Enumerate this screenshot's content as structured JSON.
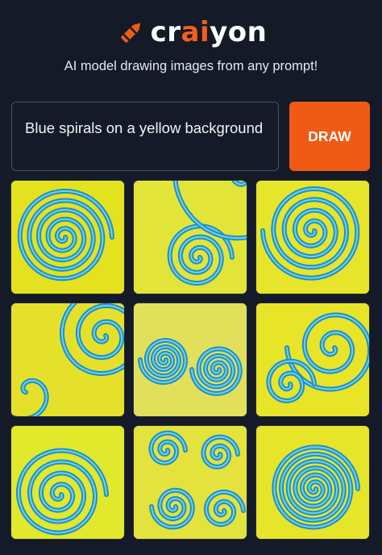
{
  "app": {
    "logo_text_prefix": "cr",
    "logo_text_accent": "ai",
    "logo_text_suffix": "yon",
    "logo_icon": "crayon-icon",
    "tagline": "AI model drawing images from any prompt!"
  },
  "prompt": {
    "value": "Blue spirals on a yellow background"
  },
  "draw_button": {
    "label": "DRAW"
  },
  "colors": {
    "background": "#141a27",
    "accent": "#ef5b14",
    "tile_yellow": "#e9e21f",
    "spiral_blue": "#2aa7d8"
  },
  "results": {
    "count": 9,
    "items": [
      {
        "description": "generated image 1"
      },
      {
        "description": "generated image 2"
      },
      {
        "description": "generated image 3"
      },
      {
        "description": "generated image 4"
      },
      {
        "description": "generated image 5"
      },
      {
        "description": "generated image 6"
      },
      {
        "description": "generated image 7"
      },
      {
        "description": "generated image 8"
      },
      {
        "description": "generated image 9"
      }
    ]
  }
}
